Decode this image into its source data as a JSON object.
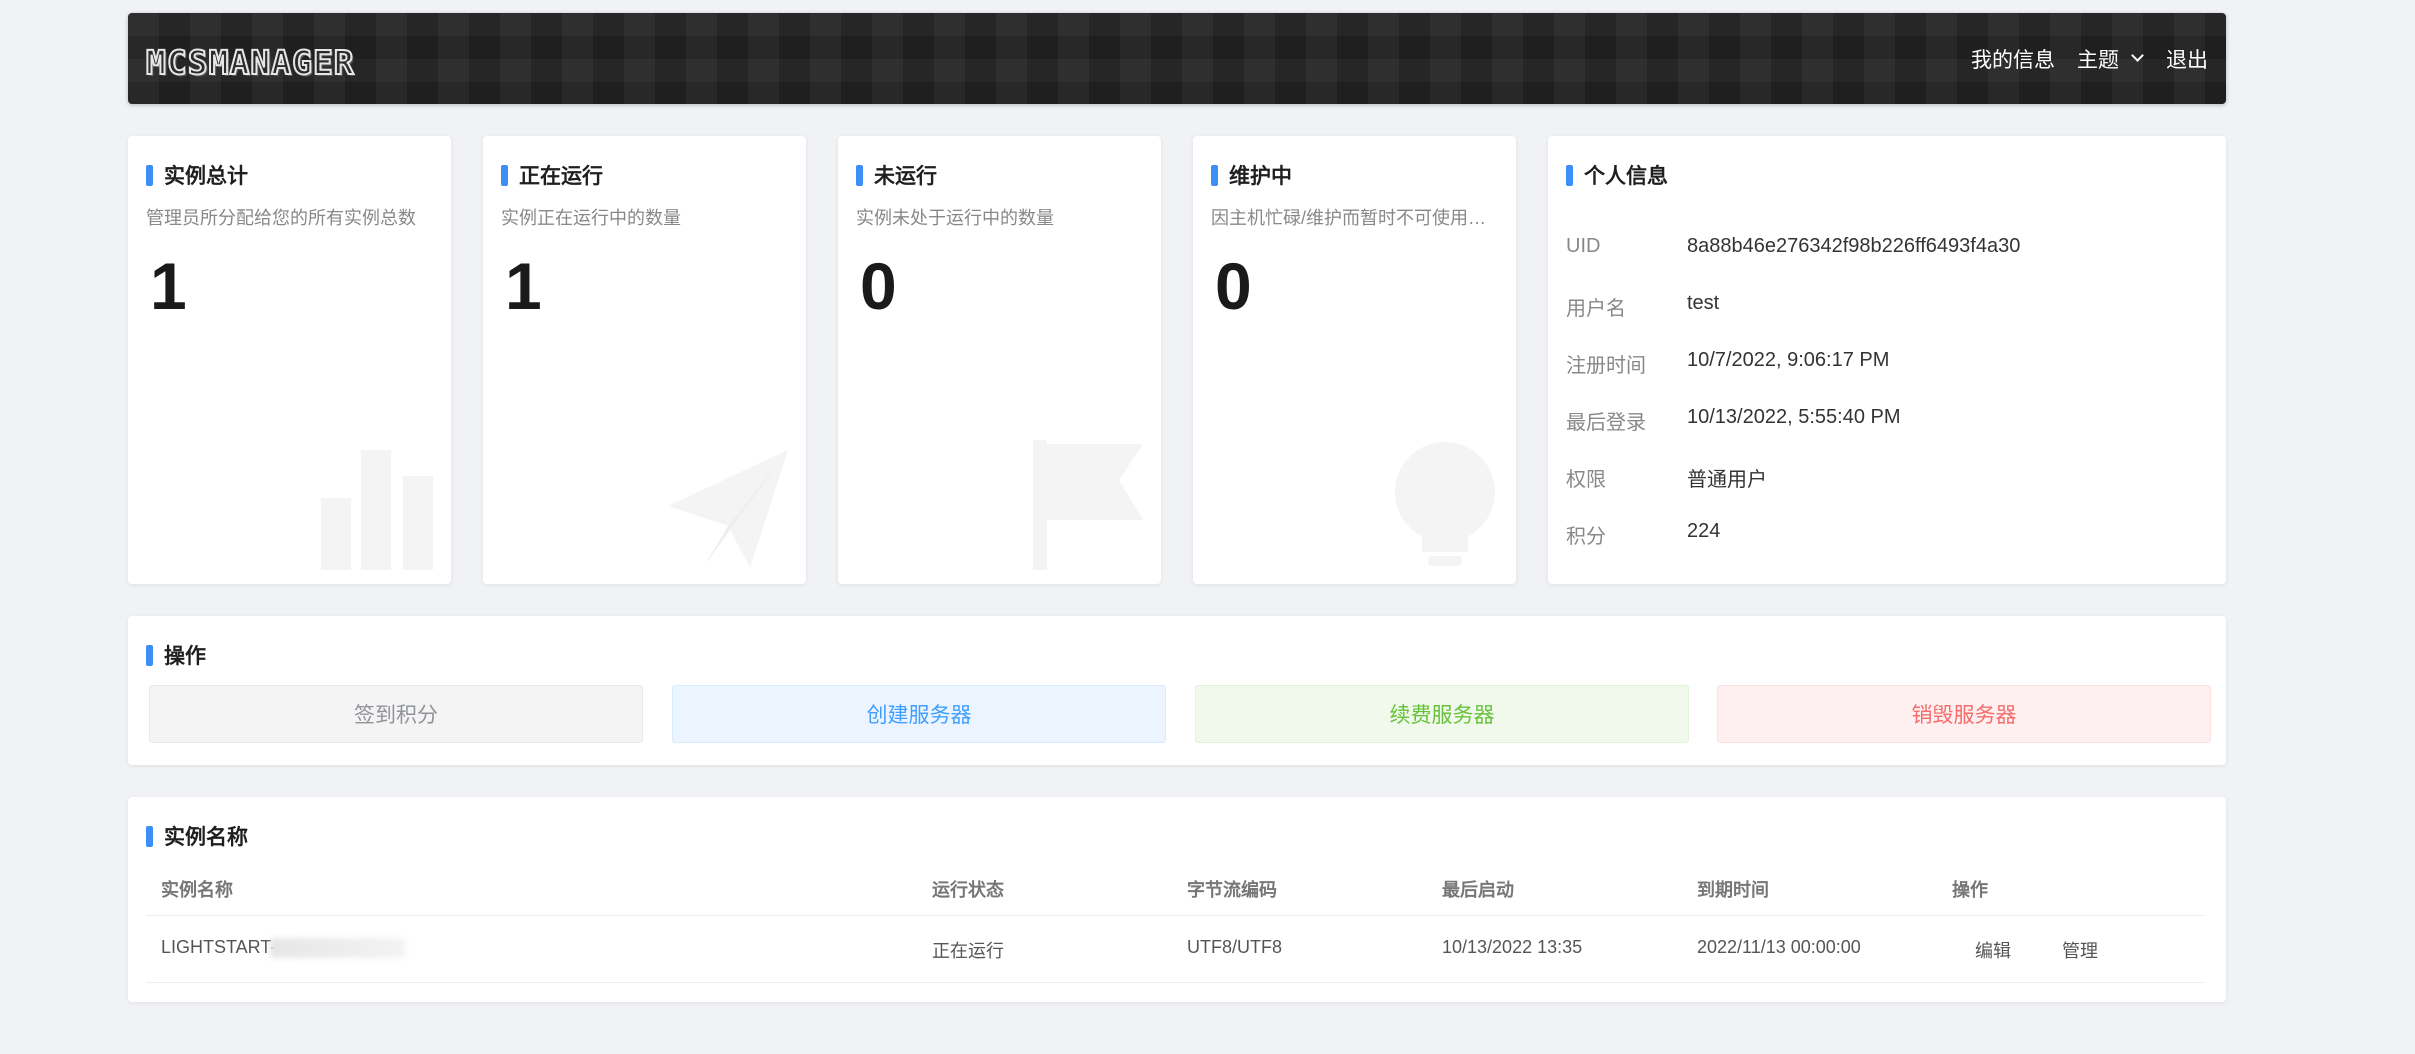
{
  "header": {
    "logo_text": "MCSMANAGER",
    "nav": {
      "my_info": "我的信息",
      "theme": "主题",
      "logout": "退出"
    }
  },
  "stats": [
    {
      "title": "实例总计",
      "desc": "管理员所分配给您的所有实例总数",
      "value": "1",
      "icon": "bar-chart-icon"
    },
    {
      "title": "正在运行",
      "desc": "实例正在运行中的数量",
      "value": "1",
      "icon": "paper-plane-icon"
    },
    {
      "title": "未运行",
      "desc": "实例未处于运行中的数量",
      "value": "0",
      "icon": "flag-icon"
    },
    {
      "title": "维护中",
      "desc": "因主机忙碌/维护而暂时不可使用的实例数量",
      "value": "0",
      "icon": "lightbulb-icon"
    }
  ],
  "profile": {
    "title": "个人信息",
    "rows": [
      {
        "key": "UID",
        "value": "8a88b46e276342f98b226ff6493f4a30"
      },
      {
        "key": "用户名",
        "value": "test"
      },
      {
        "key": "注册时间",
        "value": "10/7/2022, 9:06:17 PM"
      },
      {
        "key": "最后登录",
        "value": "10/13/2022, 5:55:40 PM"
      },
      {
        "key": "权限",
        "value": "普通用户"
      },
      {
        "key": "积分",
        "value": "224"
      }
    ]
  },
  "actions": {
    "title": "操作",
    "buttons": [
      "签到积分",
      "创建服务器",
      "续费服务器",
      "销毁服务器"
    ]
  },
  "instances": {
    "title": "实例名称",
    "columns": [
      "实例名称",
      "运行状态",
      "字节流编码",
      "最后启动",
      "到期时间",
      "操作"
    ],
    "rows": [
      {
        "name": "LIGHTSTART-",
        "status": "正在运行",
        "encoding": "UTF8/UTF8",
        "last_start": "10/13/2022 13:35",
        "expire": "2022/11/13 00:00:00",
        "edit": "编辑",
        "manage": "管理"
      }
    ]
  },
  "colors": {
    "accent": "#3d8ff5",
    "btn_signin_bg": "#f4f4f5",
    "btn_signin_fg": "#909399",
    "btn_create_bg": "#ecf5ff",
    "btn_create_fg": "#409eff",
    "btn_renew_bg": "#f0f9eb",
    "btn_renew_fg": "#67c23a",
    "btn_destroy_bg": "#fef0f0",
    "btn_destroy_fg": "#f56c6c"
  }
}
